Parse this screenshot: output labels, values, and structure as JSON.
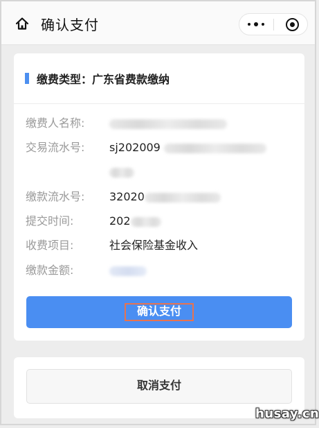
{
  "header": {
    "title": "确认支付",
    "home_icon": "home-icon",
    "more_icon": "more-icon",
    "close_icon": "close-circle-icon"
  },
  "payment": {
    "type_heading": "缴费类型：广东省费款缴纳",
    "accent_color": "#4c8ff0",
    "fields": [
      {
        "label": "缴费人名称:",
        "value": ""
      },
      {
        "label": "交易流水号:",
        "value": "sj202009"
      },
      {
        "label": "缴款流水号:",
        "value": "32020"
      },
      {
        "label": "提交时间:",
        "value": "202"
      },
      {
        "label": "收费项目:",
        "value": "社会保险基金收入"
      },
      {
        "label": "缴款金额:",
        "value": ""
      }
    ],
    "confirm_label": "确认支付",
    "confirm_color": "#4a8ef2"
  },
  "cancel": {
    "label": "取消支付"
  },
  "watermark": "husay.cn"
}
